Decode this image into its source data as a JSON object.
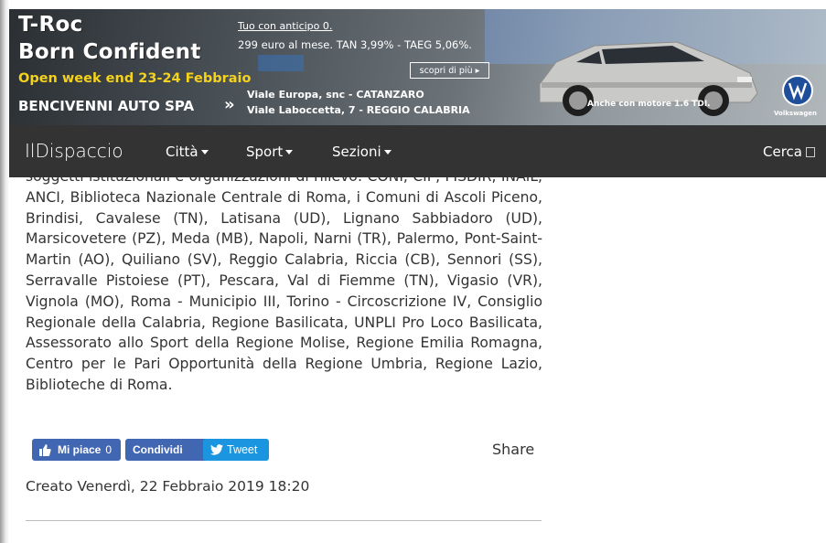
{
  "banner": {
    "title_line1": "T-Roc",
    "title_line2": "Born Confident",
    "promo": "Open week end 23-24 Febbraio",
    "dealer": "BENCIVENNI AUTO SPA",
    "arrow": "»",
    "address1": "Viale Europa, snc - CATANZARO",
    "address2": "Viale Laboccetta, 7 - REGGIO CALABRIA",
    "offer_line1": "Tuo con anticipo 0.",
    "offer_line2": "299 euro al mese. TAN 3,99% - TAEG 5,06%.",
    "cta": "scopri di più ▸",
    "engine_note": "Anche con motore 1.6 TDI.",
    "brand": "Volkswagen"
  },
  "navbar": {
    "brand": "IlDispaccio",
    "items": [
      {
        "label": "Città"
      },
      {
        "label": "Sport"
      },
      {
        "label": "Sezioni"
      }
    ],
    "search_label": "Cerca"
  },
  "article": {
    "text": "soggetti istituzionali e organizzazioni di rilievo: CONI, CIP, FISDIR, INAIL, ANCI, Biblioteca Nazionale Centrale di Roma, i Comuni di Ascoli Piceno, Brindisi, Cavalese (TN), Latisana (UD), Lignano Sabbiadoro (UD), Marsicovetere (PZ), Meda (MB), Napoli, Narni (TR), Palermo, Pont-Saint-Martin (AO), Quiliano (SV), Reggio Calabria, Riccia (CB), Sennori (SS), Serravalle Pistoiese (PT), Pescara, Val di Fiemme (TN), Vigasio (VR), Vignola (MO), Roma - Municipio III, Torino - Circoscrizione IV, Consiglio Regionale della Calabria, Regione Basilicata, UNPLI Pro Loco Basilicata, Assessorato allo Sport della Regione Molise, Regione Emilia Romagna, Centro per le Pari Opportunità della Regione Umbria, Regione Lazio, Biblioteche di Roma."
  },
  "social": {
    "like_label": "Mi piace",
    "like_count": "0",
    "share_button": "Condividi",
    "tweet_label": "Tweet",
    "share_label": "Share"
  },
  "meta": {
    "created": "Creato Venerdì, 22 Febbraio 2019 18:20"
  },
  "colors": {
    "navbar_bg": "#333333",
    "facebook_blue": "#4267b2",
    "twitter_blue": "#1b95e0",
    "promo_yellow": "#f5d21b"
  }
}
